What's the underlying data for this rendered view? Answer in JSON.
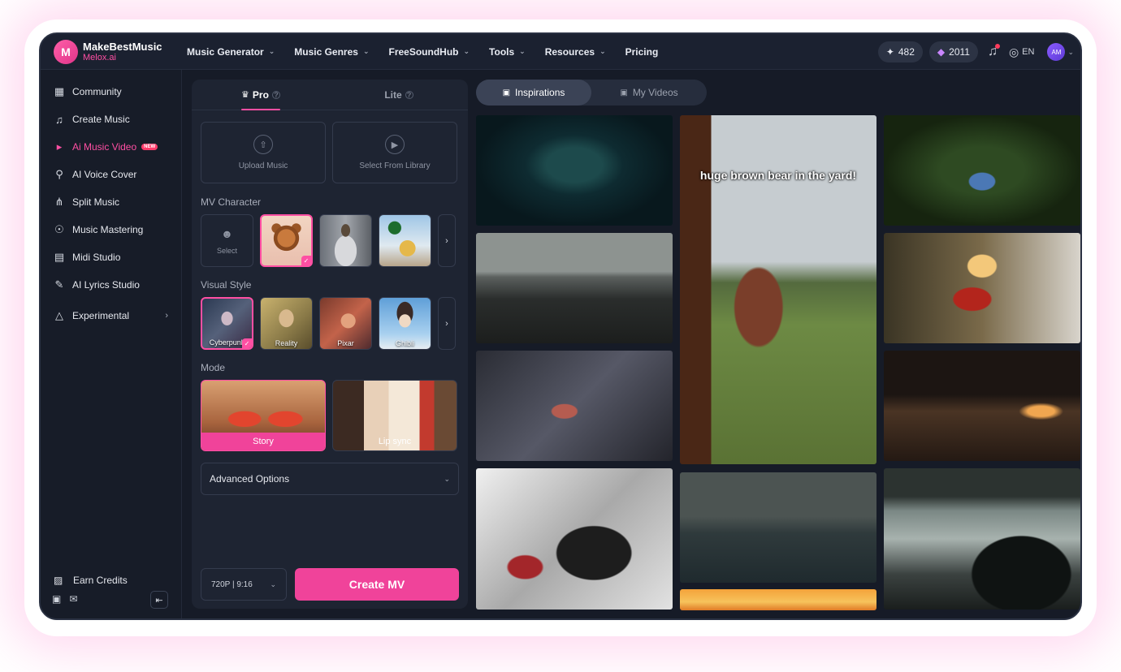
{
  "brand": {
    "name": "MakeBestMusic",
    "sub": "Melox.ai",
    "mark": "M"
  },
  "nav": {
    "items": [
      {
        "label": "Music Generator",
        "dropdown": true
      },
      {
        "label": "Music Genres",
        "dropdown": true
      },
      {
        "label": "FreeSoundHub",
        "dropdown": true
      },
      {
        "label": "Tools",
        "dropdown": true
      },
      {
        "label": "Resources",
        "dropdown": true
      },
      {
        "label": "Pricing",
        "dropdown": false
      }
    ]
  },
  "header": {
    "credits": "482",
    "gems": "2011",
    "lang": "EN",
    "avatar_initials": "AM"
  },
  "sidebar": {
    "items": [
      {
        "label": "Community",
        "icon": "community-icon"
      },
      {
        "label": "Create Music",
        "icon": "music-note-icon"
      },
      {
        "label": "Ai Music Video",
        "icon": "video-icon",
        "badge": "NEW",
        "active": true
      },
      {
        "label": "AI Voice Cover",
        "icon": "microphone-icon"
      },
      {
        "label": "Split Music",
        "icon": "split-icon"
      },
      {
        "label": "Music Mastering",
        "icon": "mastering-icon"
      },
      {
        "label": "Midi Studio",
        "icon": "piano-icon"
      },
      {
        "label": "AI Lyrics Studio",
        "icon": "lyrics-icon"
      },
      {
        "label": "Experimental",
        "icon": "flask-icon",
        "arrow": true
      }
    ],
    "earn_label": "Earn Credits"
  },
  "panel": {
    "tabs": [
      {
        "label": "Pro"
      },
      {
        "label": "Lite"
      }
    ],
    "upload_music": "Upload Music",
    "select_library": "Select From Library",
    "mv_character_label": "MV Character",
    "select_label": "Select",
    "visual_style_label": "Visual Style",
    "styles": [
      "Cyberpunk",
      "Reality",
      "Pixar",
      "Ghibli"
    ],
    "mode_label": "Mode",
    "modes": [
      "Story",
      "Lip sync"
    ],
    "advanced_label": "Advanced Options",
    "resolution": "720P | 9:16",
    "create_label": "Create MV"
  },
  "gallery": {
    "tabs": [
      "Inspirations",
      "My Videos"
    ],
    "overlay_text": "huge brown bear in the yard!"
  },
  "colors": {
    "accent": "#f0439a",
    "bg": "#161b27",
    "panel": "#1e2432"
  }
}
